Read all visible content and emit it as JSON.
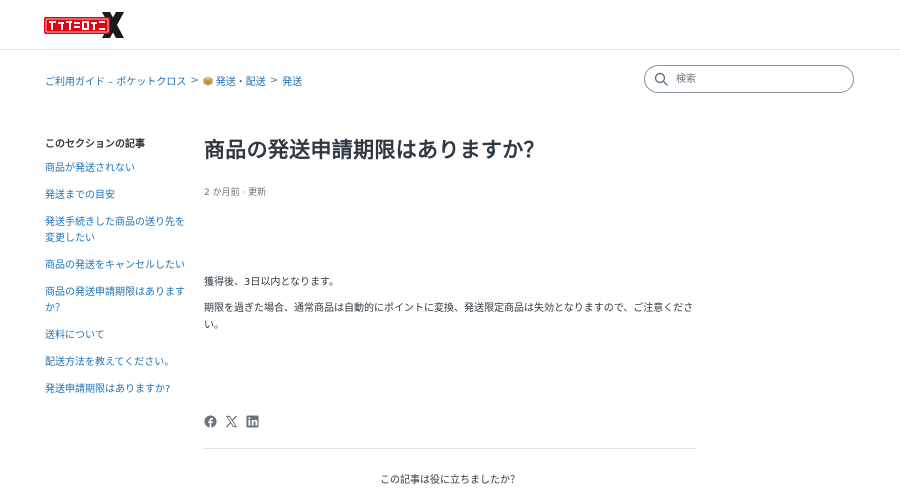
{
  "header": {
    "logo_text": "ポケットクロス",
    "brand_colors": {
      "red": "#e60012",
      "black": "#1a1a1a"
    }
  },
  "breadcrumb": {
    "items": [
      {
        "label": "ご利用ガイド – ポケットクロス"
      },
      {
        "label": "発送・配送",
        "icon": "package-icon"
      },
      {
        "label": "発送"
      }
    ],
    "separator": ">"
  },
  "search": {
    "placeholder": "検索"
  },
  "sidebar": {
    "title": "このセクションの記事",
    "items": [
      {
        "label": "商品が発送されない"
      },
      {
        "label": "発送までの目安"
      },
      {
        "label": "発送手続きした商品の送り先を変更したい"
      },
      {
        "label": "商品の発送をキャンセルしたい"
      },
      {
        "label": "商品の発送申請期限はありますか？"
      },
      {
        "label": "送料について"
      },
      {
        "label": "配送方法を教えてください。"
      },
      {
        "label": "発送申請期限はありますか?"
      }
    ]
  },
  "article": {
    "title": "商品の発送申請期限はありますか？",
    "meta": "2 か月前 ·  更新",
    "paragraphs": [
      "獲得後、3日以内となります。",
      "期限を過ぎた場合、通常商品は自動的にポイントに変換、発送限定商品は失効となりますので、ご注意ください。"
    ]
  },
  "share": {
    "icons": [
      "facebook-icon",
      "x-icon",
      "linkedin-icon"
    ]
  },
  "feedback": {
    "question": "この記事は役に立ちましたか？"
  }
}
